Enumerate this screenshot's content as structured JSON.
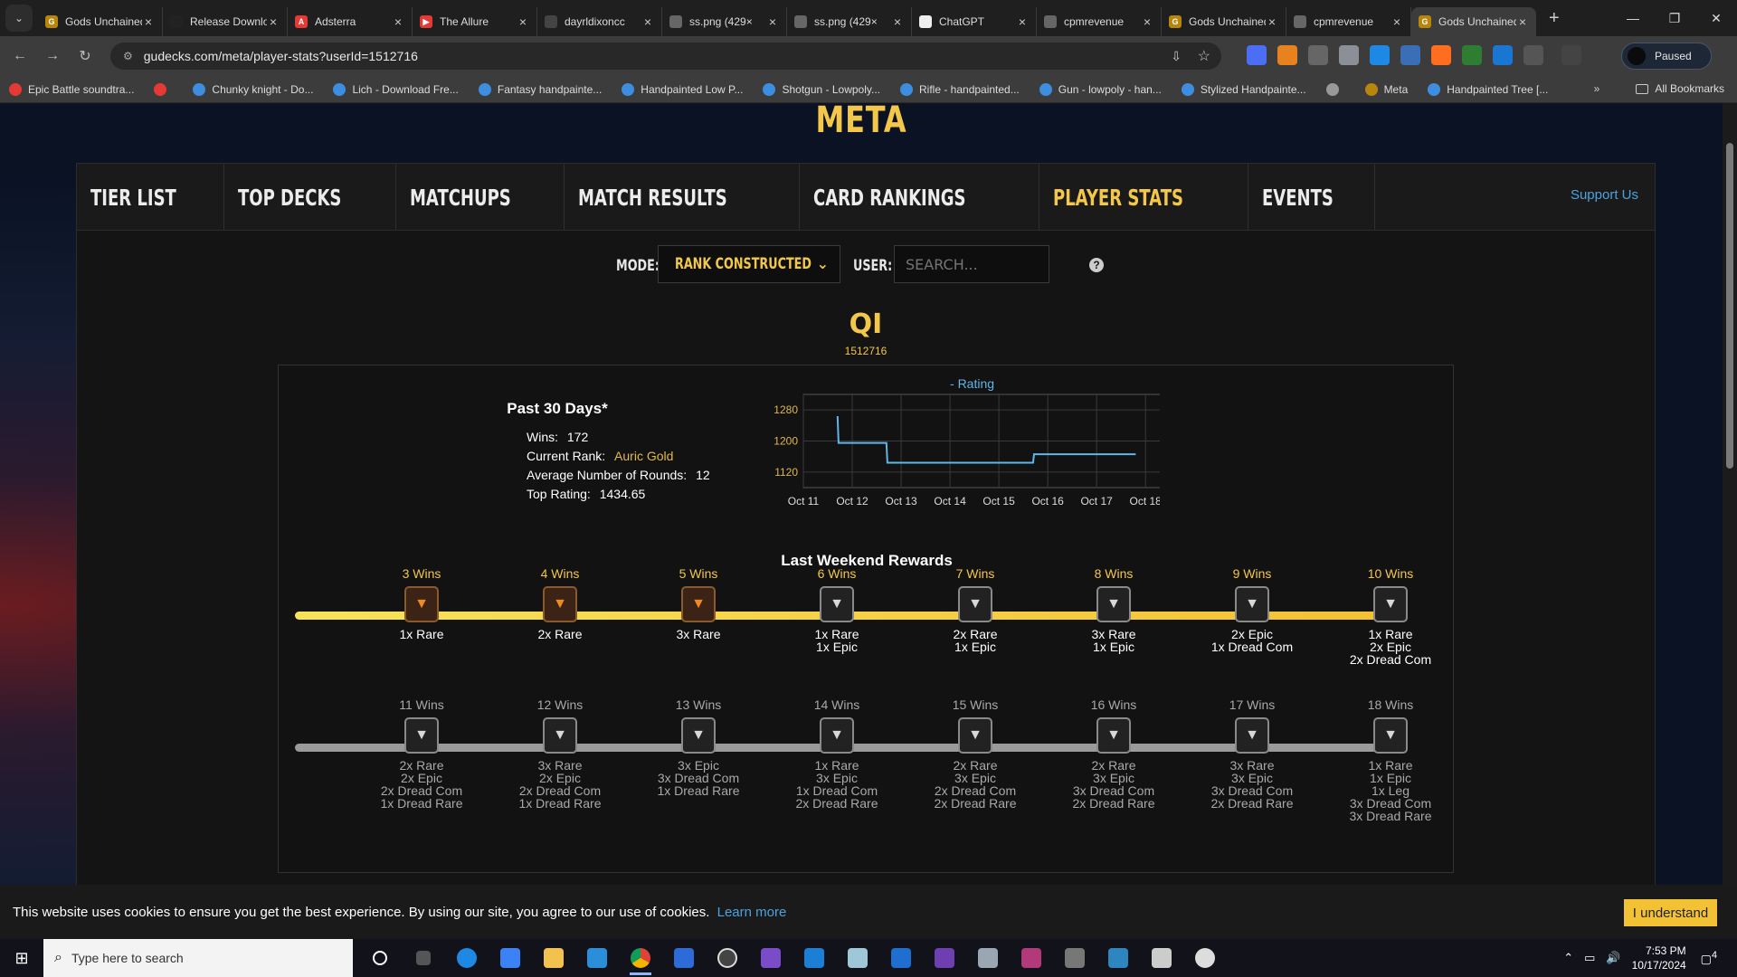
{
  "browser": {
    "tabs": [
      {
        "title": "Gods Unchained",
        "color": "#b8860b",
        "glyph": "G"
      },
      {
        "title": "Release Download",
        "color": "#222",
        "glyph": ""
      },
      {
        "title": "Adsterra",
        "color": "#e53935",
        "glyph": "A"
      },
      {
        "title": "The Allure",
        "color": "#e53935",
        "glyph": "▶"
      },
      {
        "title": "dayrldixoncc",
        "color": "#444",
        "glyph": ""
      },
      {
        "title": "ss.png (429×",
        "color": "#666",
        "glyph": ""
      },
      {
        "title": "ss.png (429×",
        "color": "#666",
        "glyph": ""
      },
      {
        "title": "ChatGPT",
        "color": "#eee",
        "glyph": ""
      },
      {
        "title": "cpmrevenue",
        "color": "#666",
        "glyph": ""
      },
      {
        "title": "Gods Unchained",
        "color": "#b8860b",
        "glyph": "G"
      },
      {
        "title": "cpmrevenue",
        "color": "#666",
        "glyph": ""
      },
      {
        "title": "Gods Unchained",
        "color": "#b8860b",
        "glyph": "G",
        "active": true
      }
    ],
    "url": "gudecks.com/meta/player-stats?userId=1512716",
    "profile_label": "Paused",
    "bookmarks": [
      {
        "label": "Epic Battle soundtra...",
        "color": "#e53935"
      },
      {
        "label": "",
        "color": "#e53935"
      },
      {
        "label": "Chunky knight - Do...",
        "color": "#3d8ee0"
      },
      {
        "label": "Lich - Download Fre...",
        "color": "#3d8ee0"
      },
      {
        "label": "Fantasy handpainte...",
        "color": "#3d8ee0"
      },
      {
        "label": "Handpainted Low P...",
        "color": "#3d8ee0"
      },
      {
        "label": "Shotgun - Lowpoly...",
        "color": "#3d8ee0"
      },
      {
        "label": "Rifle - handpainted...",
        "color": "#3d8ee0"
      },
      {
        "label": "Gun - lowpoly - han...",
        "color": "#3d8ee0"
      },
      {
        "label": "Stylized Handpainte...",
        "color": "#3d8ee0"
      },
      {
        "label": "",
        "color": "#999"
      },
      {
        "label": "Meta",
        "color": "#b8860b"
      },
      {
        "label": "Handpainted Tree [...",
        "color": "#3d8ee0"
      }
    ],
    "all_bookmarks": "All Bookmarks"
  },
  "site": {
    "title": "META",
    "nav": [
      {
        "label": "TIER LIST"
      },
      {
        "label": "TOP DECKS"
      },
      {
        "label": "MATCHUPS"
      },
      {
        "label": "MATCH RESULTS"
      },
      {
        "label": "CARD RANKINGS"
      },
      {
        "label": "PLAYER STATS",
        "active": true
      },
      {
        "label": "EVENTS"
      }
    ],
    "support": "Support Us",
    "mode_label": "MODE:",
    "mode_value": "RANK CONSTRUCTED",
    "user_label": "USER:",
    "search_placeholder": "SEARCH...",
    "help": "?"
  },
  "player": {
    "name": "QI",
    "id": "1512716"
  },
  "past": {
    "title": "Past 30 Days*",
    "wins_label": "Wins:",
    "wins": "172",
    "rank_label": "Current Rank:",
    "rank": "Auric Gold",
    "rounds_label": "Average Number of Rounds:",
    "rounds": "12",
    "top_label": "Top Rating:",
    "top": "1434.65"
  },
  "chart_data": {
    "type": "line",
    "series": [
      {
        "name": "Rating",
        "color": "#5fb6e8",
        "x": [
          11.7,
          11.72,
          12.0,
          12.7,
          12.72,
          15.7,
          15.72,
          17.8
        ],
        "y": [
          1264,
          1195,
          1195,
          1195,
          1144,
          1144,
          1166,
          1166
        ]
      }
    ],
    "x_ticks": [
      "Oct 11",
      "Oct 12",
      "Oct 13",
      "Oct 14",
      "Oct 15",
      "Oct 16",
      "Oct 17",
      "Oct 18"
    ],
    "y_ticks": [
      1280,
      1200,
      1120
    ],
    "xlim": [
      11,
      18.7
    ],
    "ylim": [
      1080,
      1320
    ],
    "grid": true,
    "legend": "top"
  },
  "rewards": {
    "title": "Last Weekend Rewards",
    "top": [
      {
        "wins": "3 Wins",
        "items": [
          "1x Rare"
        ],
        "chest": "bronze"
      },
      {
        "wins": "4 Wins",
        "items": [
          "2x Rare"
        ],
        "chest": "bronze"
      },
      {
        "wins": "5 Wins",
        "items": [
          "3x Rare"
        ],
        "chest": "bronze"
      },
      {
        "wins": "6 Wins",
        "items": [
          "1x Rare",
          "1x Epic"
        ],
        "chest": "steel"
      },
      {
        "wins": "7 Wins",
        "items": [
          "2x Rare",
          "1x Epic"
        ],
        "chest": "steel"
      },
      {
        "wins": "8 Wins",
        "items": [
          "3x Rare",
          "1x Epic"
        ],
        "chest": "steel"
      },
      {
        "wins": "9 Wins",
        "items": [
          "2x Epic",
          "1x Dread Com"
        ],
        "chest": "steel"
      },
      {
        "wins": "10 Wins",
        "items": [
          "1x Rare",
          "2x Epic",
          "2x Dread Com"
        ],
        "chest": "steel"
      }
    ],
    "bottom": [
      {
        "wins": "11 Wins",
        "items": [
          "2x Rare",
          "2x Epic",
          "2x Dread Com",
          "1x Dread Rare"
        ]
      },
      {
        "wins": "12 Wins",
        "items": [
          "3x Rare",
          "2x Epic",
          "2x Dread Com",
          "1x Dread Rare"
        ]
      },
      {
        "wins": "13 Wins",
        "items": [
          "3x Epic",
          "3x Dread Com",
          "1x Dread Rare"
        ]
      },
      {
        "wins": "14 Wins",
        "items": [
          "1x Rare",
          "3x Epic",
          "1x Dread Com",
          "2x Dread Rare"
        ]
      },
      {
        "wins": "15 Wins",
        "items": [
          "2x Rare",
          "3x Epic",
          "2x Dread Com",
          "2x Dread Rare"
        ]
      },
      {
        "wins": "16 Wins",
        "items": [
          "2x Rare",
          "3x Epic",
          "3x Dread Com",
          "2x Dread Rare"
        ]
      },
      {
        "wins": "17 Wins",
        "items": [
          "3x Rare",
          "3x Epic",
          "3x Dread Com",
          "2x Dread Rare"
        ]
      },
      {
        "wins": "18 Wins",
        "items": [
          "1x Rare",
          "1x Epic",
          "1x Leg",
          "3x Dread Com",
          "3x Dread Rare"
        ]
      }
    ]
  },
  "cookie": {
    "message": "This website uses cookies to ensure you get the best experience. By using our site, you agree to our use of cookies.",
    "link": "Learn more",
    "button": "I understand"
  },
  "taskbar": {
    "search_placeholder": "Type here to search",
    "time": "7:53 PM",
    "date": "10/17/2024",
    "notifications": "4"
  }
}
